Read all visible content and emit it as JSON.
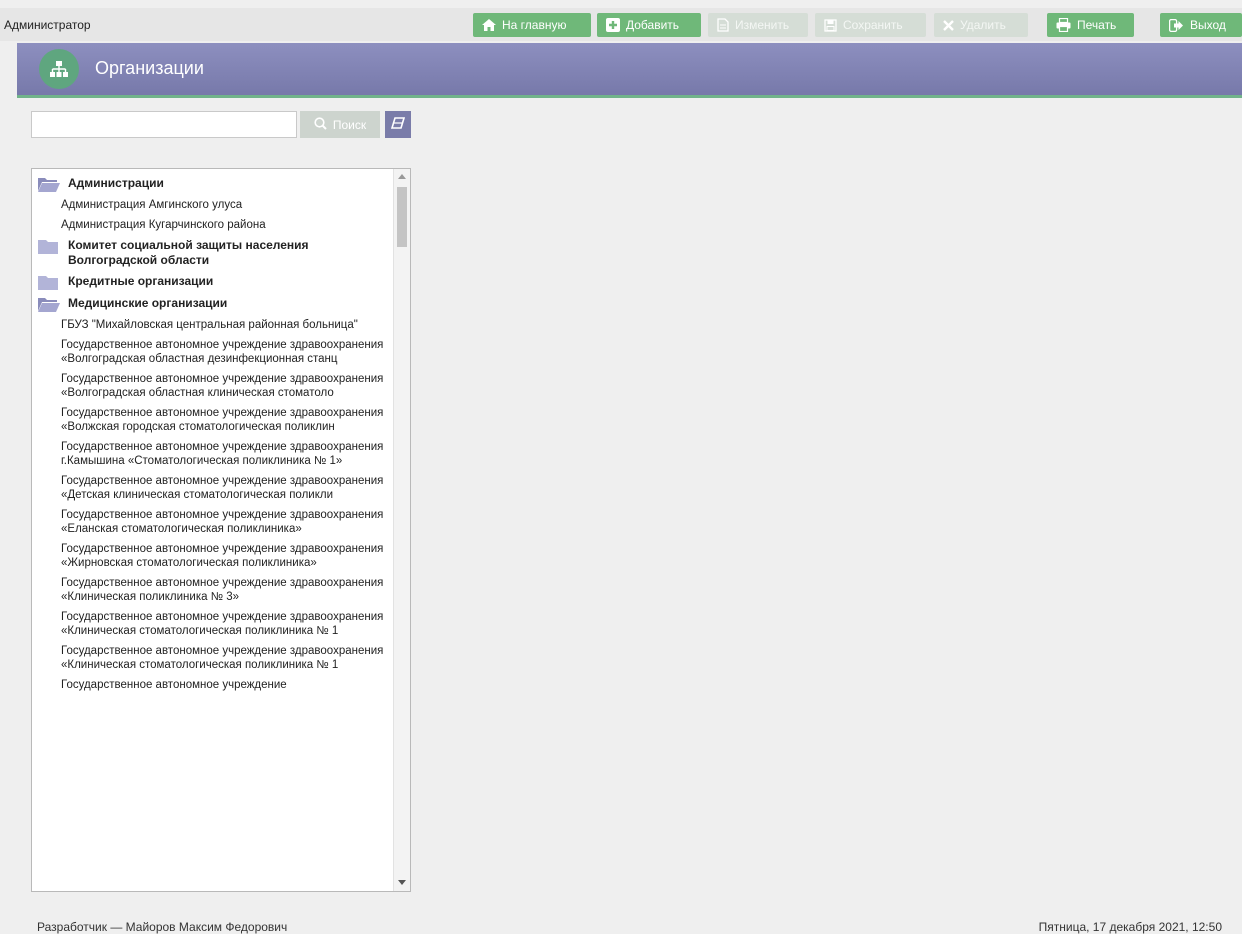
{
  "app": {
    "user": "Администратор"
  },
  "toolbar": {
    "home": "На главную",
    "add": "Добавить",
    "edit": "Изменить",
    "save": "Сохранить",
    "delete": "Удалить",
    "print": "Печать",
    "exit": "Выход"
  },
  "header": {
    "title": "Организации",
    "icon": "org-hierarchy-icon"
  },
  "search": {
    "value": "",
    "placeholder": "",
    "button": "Поиск"
  },
  "tree": {
    "groups": [
      {
        "label": "Администрации",
        "open": true,
        "items": [
          "Администрация Амгинского улуса",
          "Администрация Кугарчинского района"
        ]
      },
      {
        "label": "Комитет социальной защиты населения Волгоградской области",
        "open": false,
        "items": []
      },
      {
        "label": "Кредитные организации",
        "open": false,
        "items": []
      },
      {
        "label": "Медицинские организации",
        "open": true,
        "items": [
          "ГБУЗ \"Михайловская центральная районная больница\"",
          "Государственное автономное учреждение здравоохранения «Волгоградская областная дезинфекционная станц",
          "Государственное автономное учреждение здравоохранения «Волгоградская областная клиническая стоматоло",
          "Государственное автономное учреждение здравоохранения «Волжская городская стоматологическая поликлин",
          "Государственное автономное учреждение здравоохранения г.Камышина «Стоматологическая поликлиника № 1»",
          "Государственное автономное учреждение здравоохранения «Детская клиническая стоматологическая поликли",
          "Государственное автономное учреждение здравоохранения «Еланская стоматологическая поликлиника»",
          "Государственное автономное учреждение здравоохранения «Жирновская стоматологическая поликлиника»",
          "Государственное автономное учреждение здравоохранения «Клиническая поликлиника № 3»",
          "Государственное автономное учреждение здравоохранения «Клиническая стоматологическая поликлиника № 1",
          "Государственное автономное учреждение здравоохранения «Клиническая стоматологическая поликлиника № 1",
          "Государственное автономное учреждение"
        ]
      }
    ]
  },
  "footer": {
    "developer": "Разработчик — Майоров Максим Федорович",
    "datetime": "Пятница, 17 декабря 2021, 12:50"
  },
  "colors": {
    "accent_green": "#6fb879",
    "header_purple": "#8284b5",
    "header_border": "#71b38a"
  }
}
